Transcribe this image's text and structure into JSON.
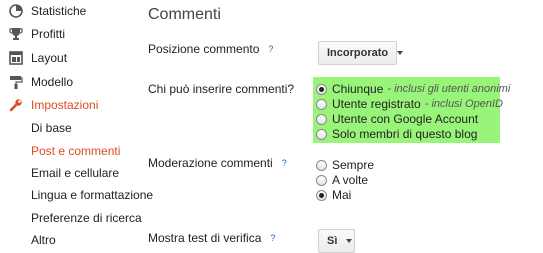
{
  "sidebar": {
    "items": [
      {
        "label": "Statistiche",
        "icon": "bar-chart-icon"
      },
      {
        "label": "Profitti",
        "icon": "trophy-icon"
      },
      {
        "label": "Layout",
        "icon": "layout-icon"
      },
      {
        "label": "Modello",
        "icon": "paint-roller-icon"
      },
      {
        "label": "Impostazioni",
        "icon": "wrench-icon"
      }
    ],
    "subitems": [
      {
        "label": "Di base"
      },
      {
        "label": "Post e commenti"
      },
      {
        "label": "Email e cellulare"
      },
      {
        "label": "Lingua e formattazione"
      },
      {
        "label": "Preferenze di ricerca"
      },
      {
        "label": "Altro"
      }
    ]
  },
  "main": {
    "title": "Commenti",
    "help_glyph": "?",
    "position": {
      "label": "Posizione commento",
      "value": "Incorporato"
    },
    "who": {
      "label": "Chi può inserire commenti?",
      "options": [
        {
          "label": "Chiunque",
          "hint": "- inclusi gli utenti anonimi",
          "checked": true
        },
        {
          "label": "Utente registrato",
          "hint": "- inclusi OpenID",
          "checked": false
        },
        {
          "label": "Utente con Google Account",
          "hint": "",
          "checked": false
        },
        {
          "label": "Solo membri di questo blog",
          "hint": "",
          "checked": false
        }
      ]
    },
    "moderation": {
      "label": "Moderazione commenti",
      "options": [
        {
          "label": "Sempre",
          "checked": false
        },
        {
          "label": "A volte",
          "checked": false
        },
        {
          "label": "Mai",
          "checked": true
        }
      ]
    },
    "captcha": {
      "label": "Mostra test di verifica",
      "value": "Sì"
    }
  },
  "colors": {
    "accent": "#dd4b1e",
    "highlight": "#98f57a",
    "help": "#1a64c4"
  }
}
